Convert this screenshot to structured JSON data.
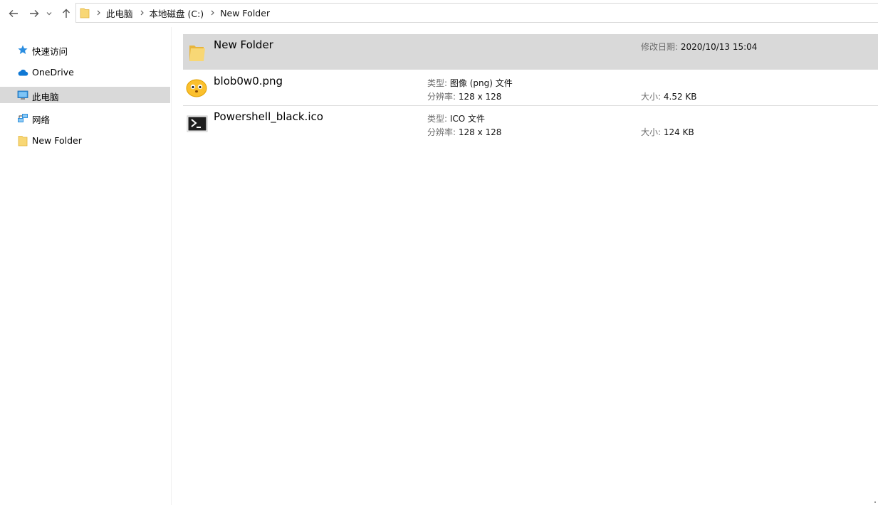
{
  "nav": {
    "back_icon": "arrow-left-icon",
    "forward_icon": "arrow-right-icon",
    "recent_icon": "chevron-down-icon",
    "up_icon": "arrow-up-icon"
  },
  "address": {
    "crumbs": [
      "此电脑",
      "本地磁盘 (C:)",
      "New Folder"
    ]
  },
  "sidebar": {
    "items": [
      {
        "label": "快速访问",
        "icon": "star-icon"
      },
      {
        "label": "OneDrive",
        "icon": "cloud-icon"
      },
      {
        "label": "此电脑",
        "icon": "computer-icon"
      },
      {
        "label": "网络",
        "icon": "network-icon"
      },
      {
        "label": "New Folder",
        "icon": "folder-icon"
      }
    ],
    "selected": "此电脑"
  },
  "files": [
    {
      "name": "New Folder",
      "icon": "folder-icon",
      "modified_label": "修改日期:",
      "modified_value": "2020/10/13 15:04"
    },
    {
      "name": "blob0w0.png",
      "icon": "blob-emoji-icon",
      "type_label": "类型:",
      "type_value": "图像 (png) 文件",
      "res_label": "分辨率:",
      "res_value": "128 x 128",
      "size_label": "大小:",
      "size_value": "4.52 KB"
    },
    {
      "name": "Powershell_black.ico",
      "icon": "powershell-icon",
      "type_label": "类型:",
      "type_value": "ICO 文件",
      "res_label": "分辨率:",
      "res_value": "128 x 128",
      "size_label": "大小:",
      "size_value": "124 KB"
    }
  ],
  "colors": {
    "selection": "#d9d9d9",
    "folder": "#f8d775",
    "accent": "#0078d7"
  }
}
